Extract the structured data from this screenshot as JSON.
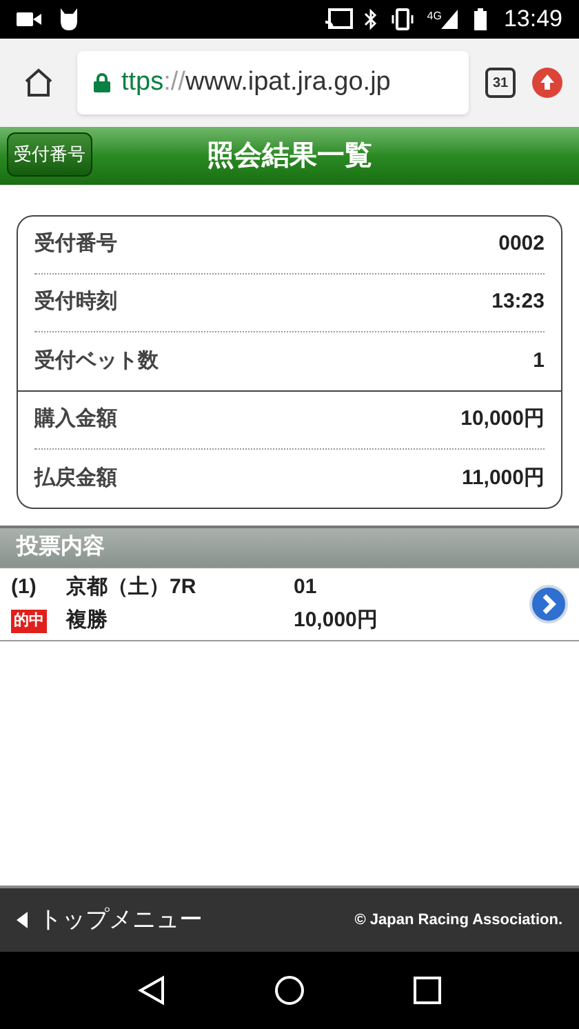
{
  "status_bar": {
    "network": "4G",
    "time": "13:49"
  },
  "browser": {
    "url_scheme": "ttps",
    "url_separator": "://",
    "url_host": "www.ipat.jra.go.jp",
    "calendar_day": "31"
  },
  "header": {
    "back_label": "受付番号",
    "title": "照会結果一覧"
  },
  "reception": [
    {
      "label": "受付番号",
      "value": "0002"
    },
    {
      "label": "受付時刻",
      "value": "13:23"
    },
    {
      "label": "受付ベット数",
      "value": "1"
    }
  ],
  "amounts": [
    {
      "label": "購入金額",
      "value": "10,000円"
    },
    {
      "label": "払戻金額",
      "value": "11,000円"
    }
  ],
  "section": {
    "title": "投票内容"
  },
  "bets": [
    {
      "number": "(1)",
      "race": "京都（土）7R",
      "horses": "01",
      "won": true,
      "badge": "的中",
      "bet_type": "複勝",
      "amount": "10,000円"
    }
  ],
  "footer": {
    "menu_label": "トップメニュー",
    "copyright": "© Japan Racing Association."
  }
}
